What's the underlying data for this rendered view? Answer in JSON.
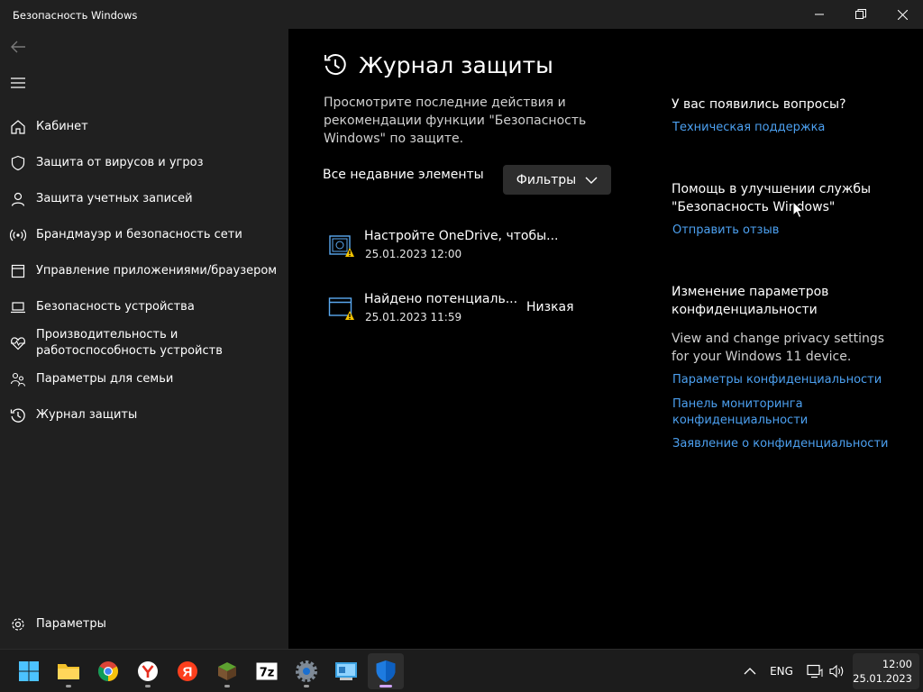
{
  "window": {
    "title": "Безопасность Windows"
  },
  "sidebar": {
    "items": [
      {
        "label": "Кабинет",
        "icon": "home-icon"
      },
      {
        "label": "Защита от вирусов и угроз",
        "icon": "shield-icon"
      },
      {
        "label": "Защита учетных записей",
        "icon": "person-icon"
      },
      {
        "label": "Брандмауэр и безопасность сети",
        "icon": "wifi-antenna-icon"
      },
      {
        "label": "Управление приложениями/браузером",
        "icon": "app-window-icon"
      },
      {
        "label": "Безопасность устройства",
        "icon": "laptop-icon"
      },
      {
        "label": "Производительность и работоспособность устройств",
        "icon": "heart-pulse-icon"
      },
      {
        "label": "Параметры для семьи",
        "icon": "family-icon"
      },
      {
        "label": "Журнал защиты",
        "icon": "history-icon"
      }
    ],
    "settings_label": "Параметры"
  },
  "main": {
    "title": "Журнал защиты",
    "description": "Просмотрите последние действия и рекомендации функции \"Безопасность Windows\" по защите.",
    "recent_label": "Все недавние элементы",
    "filter_label": "Фильтры",
    "items": [
      {
        "title": "Настройте OneDrive, чтобы...",
        "date": "25.01.2023 12:00",
        "severity": ""
      },
      {
        "title": "Найдено потенциаль...",
        "date": "25.01.2023 11:59",
        "severity": "Низкая"
      }
    ]
  },
  "aside": {
    "questions_heading": "У вас появились вопросы?",
    "support_link": "Техническая поддержка",
    "improve_heading": "Помощь в улучшении службы \"Безопасность Windows\"",
    "feedback_link": "Отправить отзыв",
    "privacy_heading": "Изменение параметров конфиденциальности",
    "privacy_text": "View and change privacy settings for your Windows 11 device.",
    "privacy_links": [
      "Параметры конфиденциальности",
      "Панель мониторинга конфиденциальности",
      "Заявление о конфиденциальности"
    ]
  },
  "taskbar": {
    "apps": [
      "start-icon",
      "file-explorer-icon",
      "chrome-icon",
      "yandex-browser-icon",
      "yandex-icon",
      "minecraft-icon",
      "7zip-icon",
      "settings-gear-icon",
      "control-panel-icon",
      "windows-security-icon"
    ],
    "language": "ENG",
    "time": "12:00",
    "date": "25.01.2023"
  },
  "colors": {
    "accent_link": "#4ca0f0",
    "warning": "#f5c400",
    "sidebar_bg": "#202020",
    "main_bg": "#000000"
  }
}
